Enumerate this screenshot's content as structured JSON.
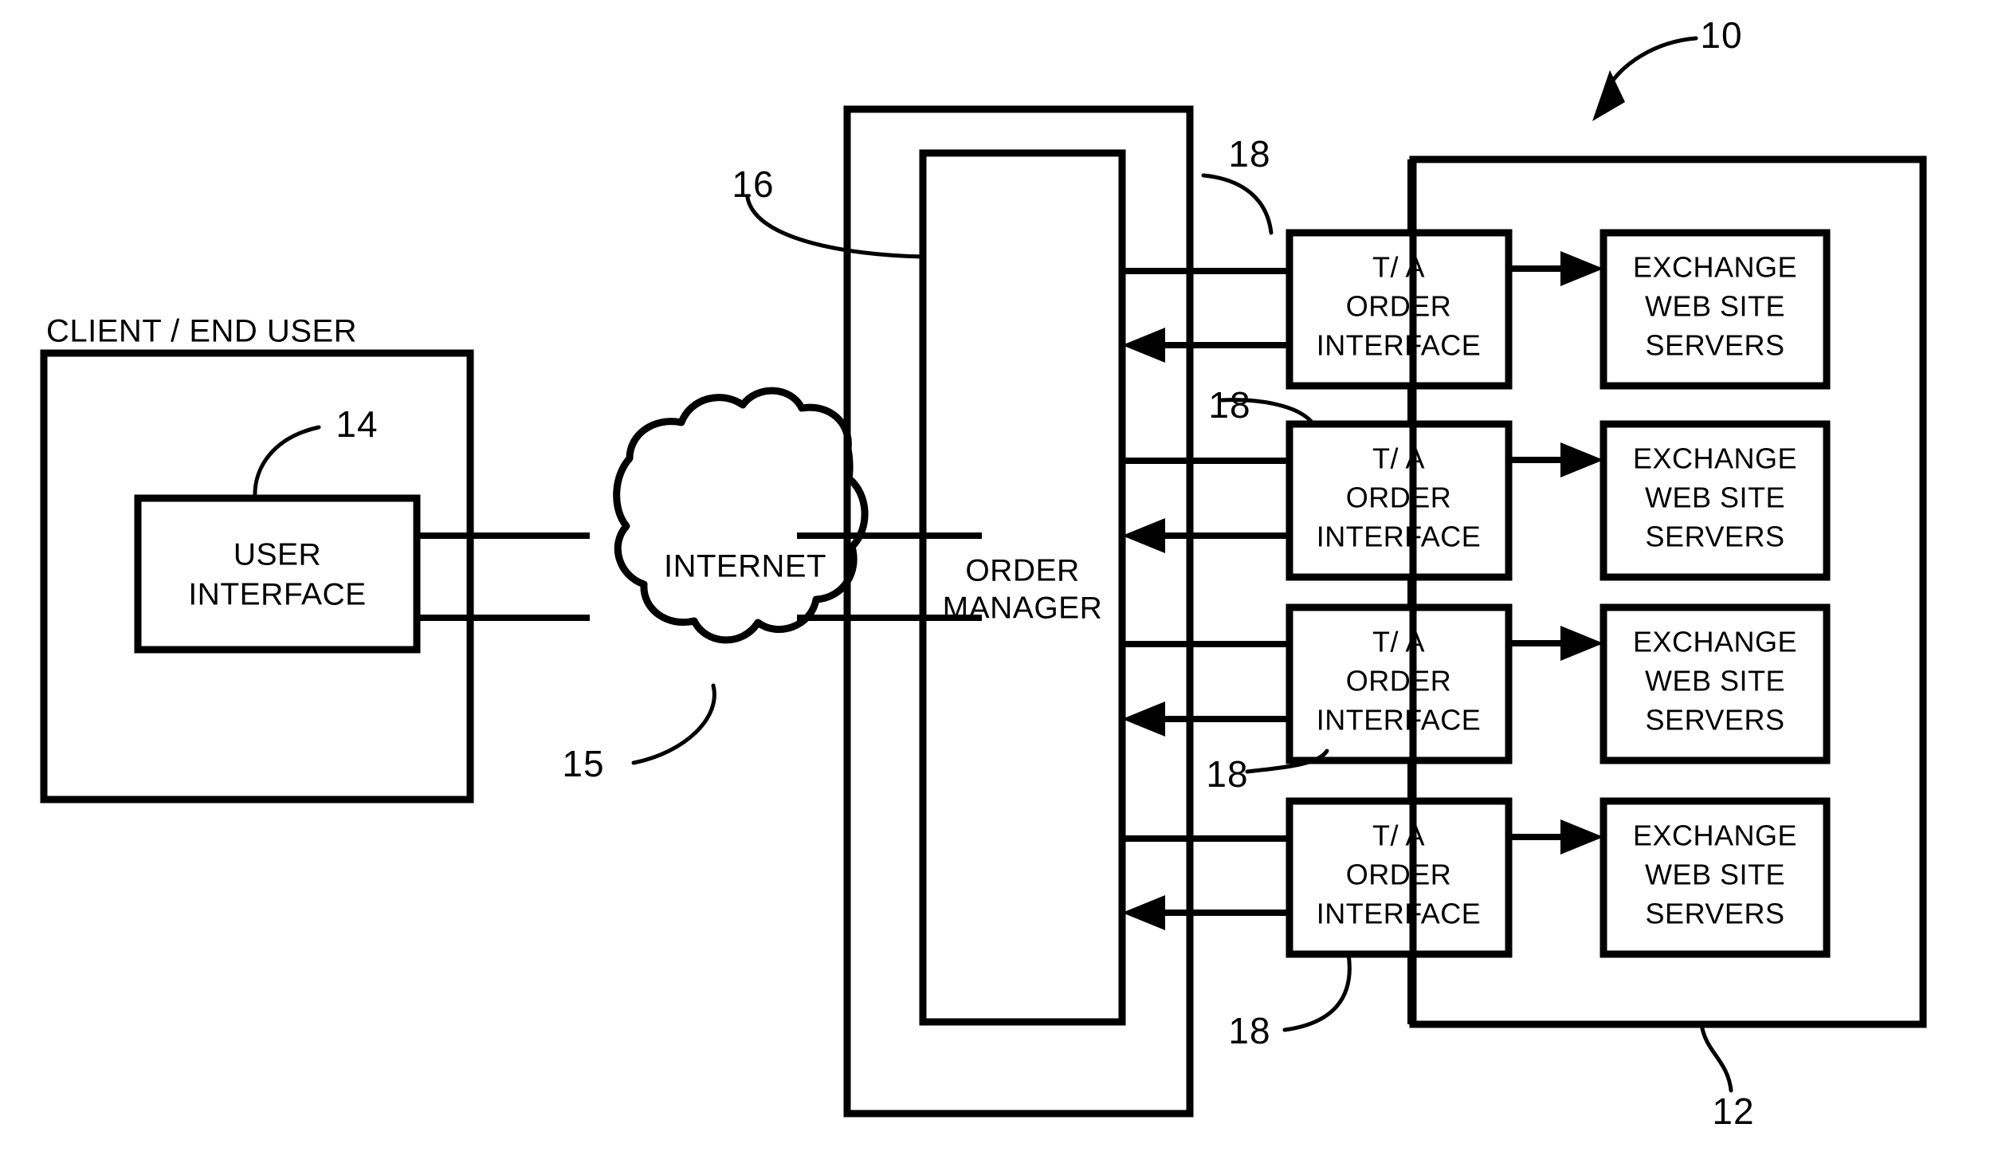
{
  "figure": {
    "title": "Patent Figure - Order Routing System Block Diagram",
    "background_color": "#ffffff",
    "line_color": "#000000"
  },
  "labels": {
    "client_end_user": "CLIENT / END USER",
    "user_interface_line1": "USER",
    "user_interface_line2": "INTERFACE",
    "internet": "INTERNET",
    "order_manager_line1": "ORDER",
    "order_manager_line2": "MANAGER"
  },
  "ta_interfaces": [
    {
      "line1": "T/ A",
      "line2": "ORDER",
      "line3": "INTERFACE"
    },
    {
      "line1": "T/ A",
      "line2": "ORDER",
      "line3": "INTERFACE"
    },
    {
      "line1": "T/ A",
      "line2": "ORDER",
      "line3": "INTERFACE"
    },
    {
      "line1": "T/ A",
      "line2": "ORDER",
      "line3": "INTERFACE"
    }
  ],
  "exchange_servers": [
    {
      "line1": "EXCHANGE",
      "line2": "WEB SITE",
      "line3": "SERVERS"
    },
    {
      "line1": "EXCHANGE",
      "line2": "WEB SITE",
      "line3": "SERVERS"
    },
    {
      "line1": "EXCHANGE",
      "line2": "WEB SITE",
      "line3": "SERVERS"
    },
    {
      "line1": "EXCHANGE",
      "line2": "WEB SITE",
      "line3": "SERVERS"
    }
  ],
  "reference_numerals": {
    "system": "10",
    "exchange_group": "12",
    "user_interface": "14",
    "internet": "15",
    "order_system": "16",
    "ta_interface_1": "18",
    "ta_interface_2": "18",
    "ta_interface_3": "18",
    "ta_interface_4": "18"
  }
}
